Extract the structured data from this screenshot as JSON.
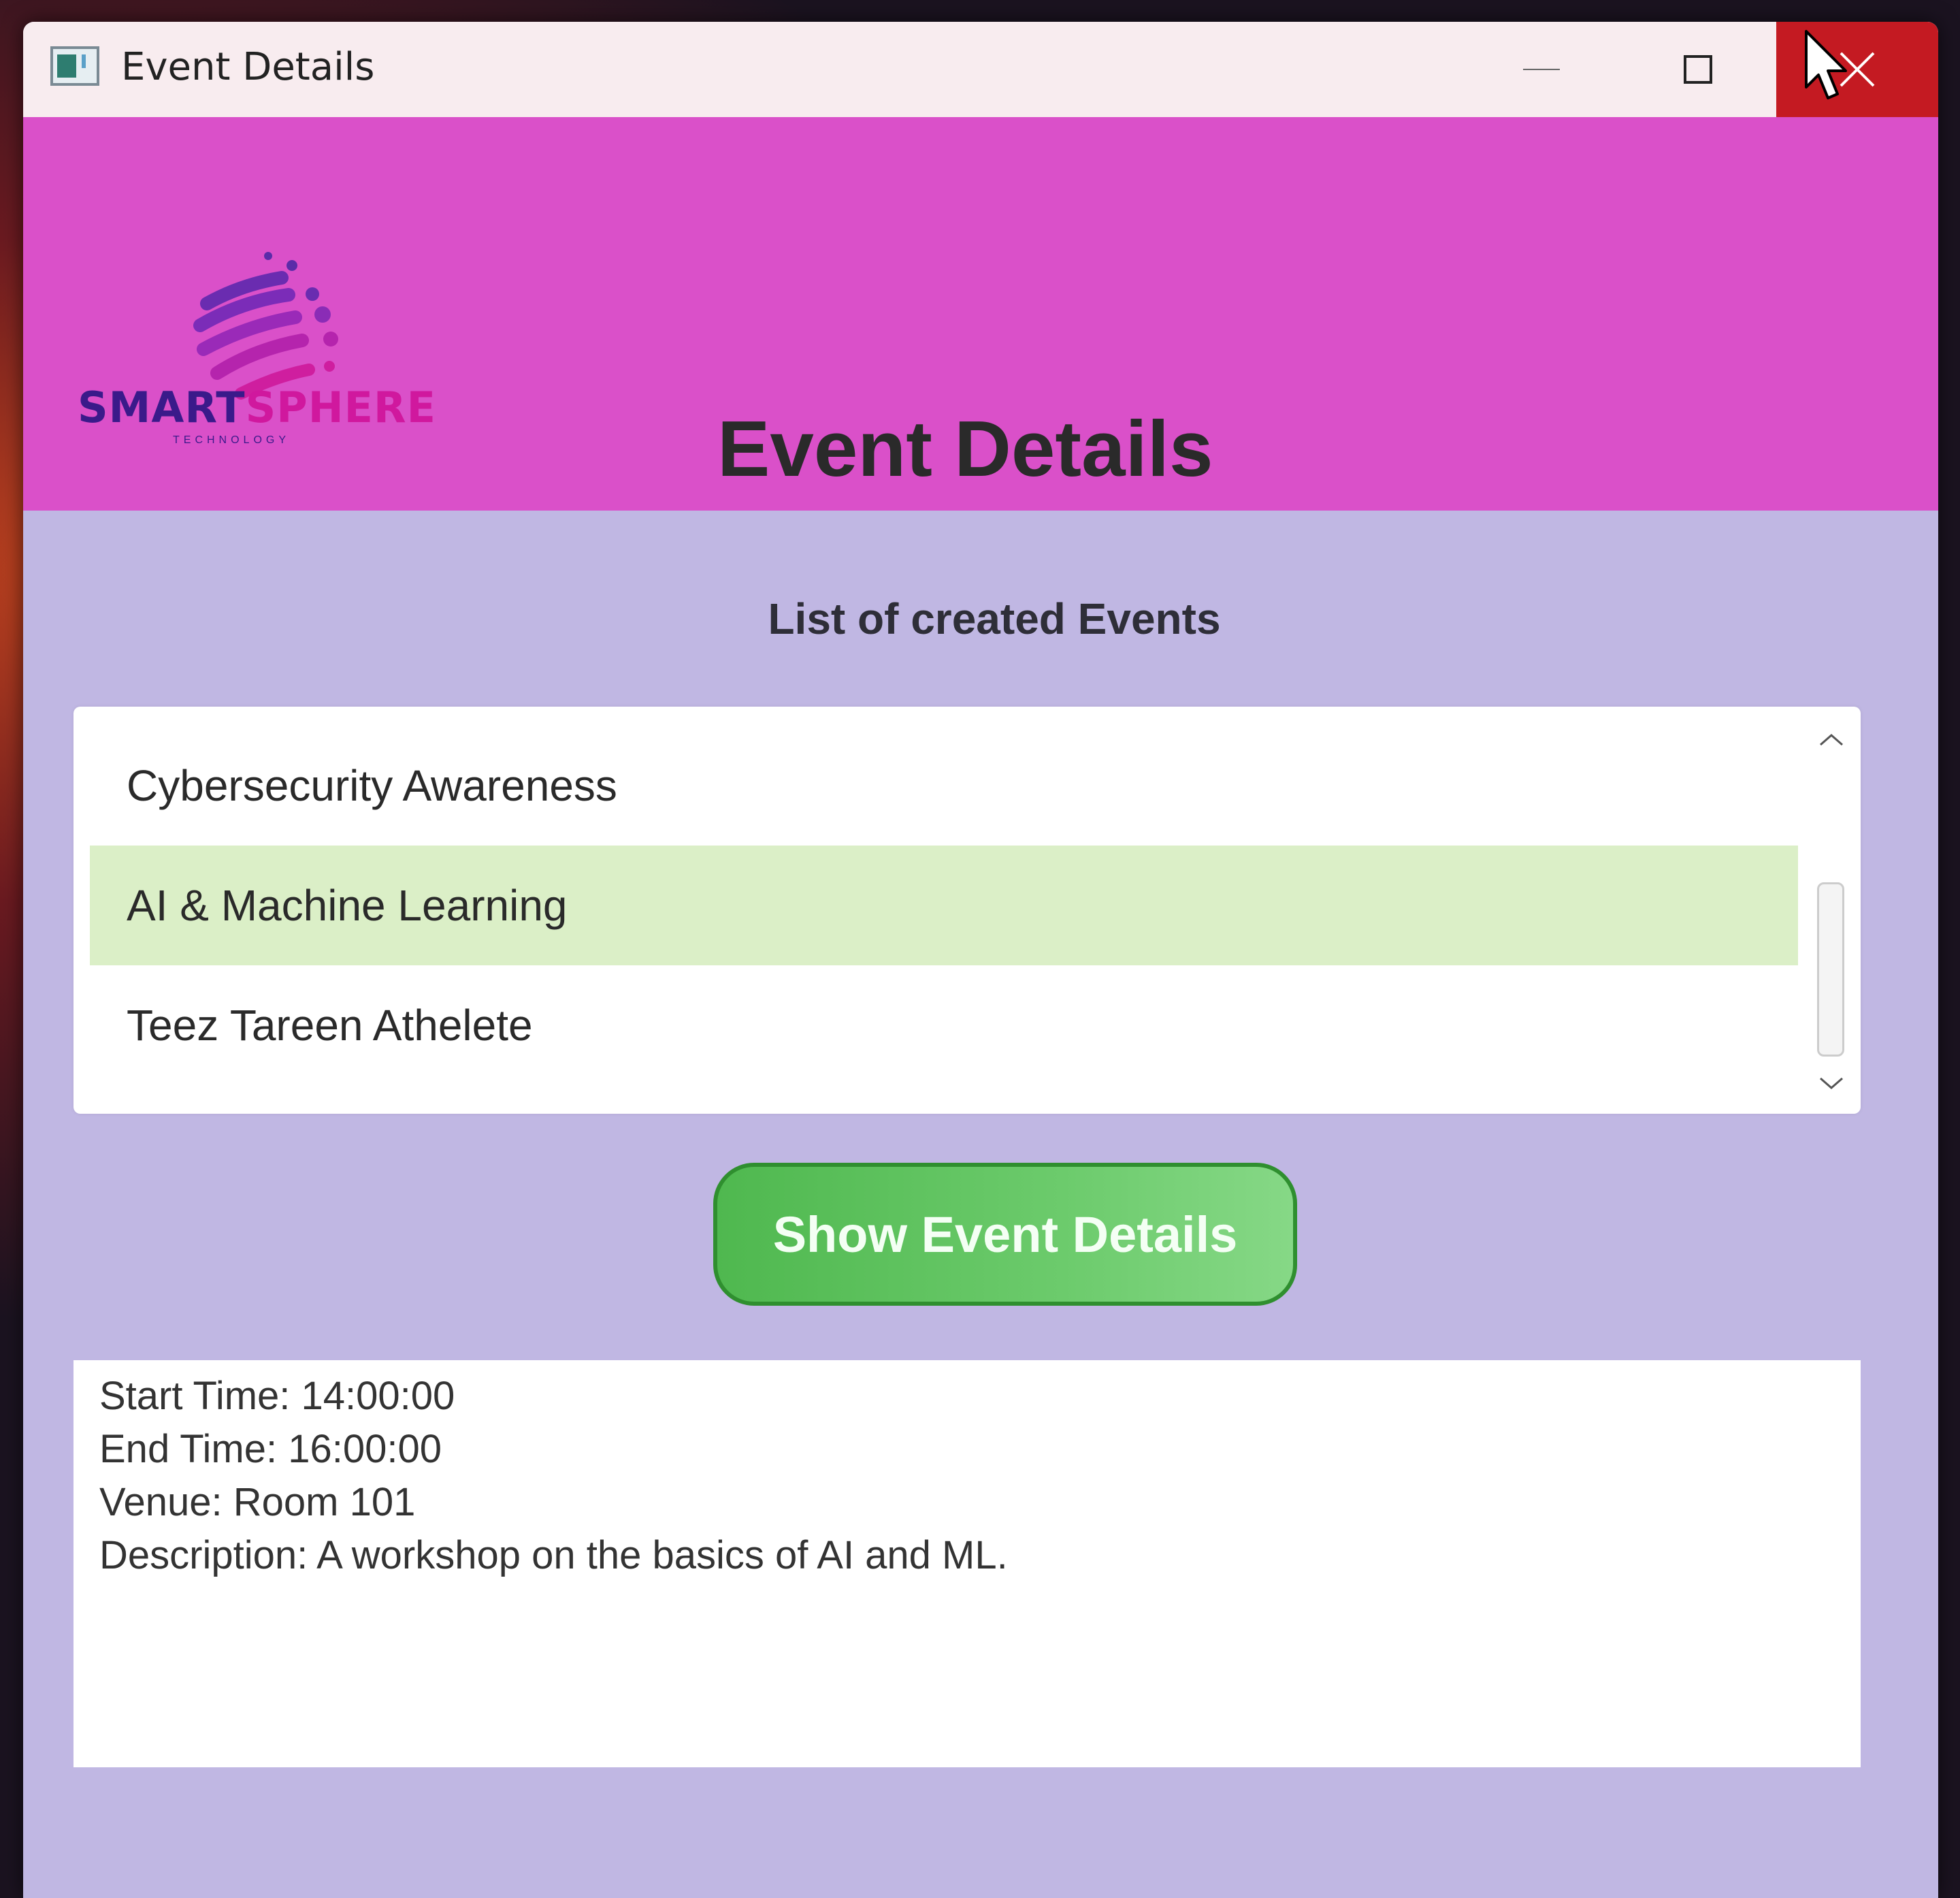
{
  "window": {
    "title": "Event Details",
    "controls": {
      "minimize_icon": "minimize-icon",
      "maximize_icon": "maximize-icon",
      "close_icon": "close-icon"
    }
  },
  "header": {
    "logo": {
      "word1": "SMART",
      "word2": "SPHERE",
      "tagline": "TECHNOLOGY"
    },
    "title": "Event Details",
    "background": "#da50c9"
  },
  "events": {
    "label": "List of created Events",
    "items": [
      {
        "label": "Cybersecurity Awareness",
        "selected": false
      },
      {
        "label": "AI & Machine Learning",
        "selected": true
      },
      {
        "label": "Teez Tareen Athelete",
        "selected": false
      }
    ]
  },
  "actions": {
    "show_details_label": "Show Event Details"
  },
  "details": {
    "lines": [
      "Start Time: 14:00:00",
      "End Time: 16:00:00",
      "Venue: Room 101",
      "Description: A workshop on the basics of AI and ML."
    ]
  },
  "colors": {
    "body_background": "#c0b7e3",
    "selected_row": "#dbefc7",
    "button_green": "#4fb84f",
    "close_red": "#c41a22"
  }
}
